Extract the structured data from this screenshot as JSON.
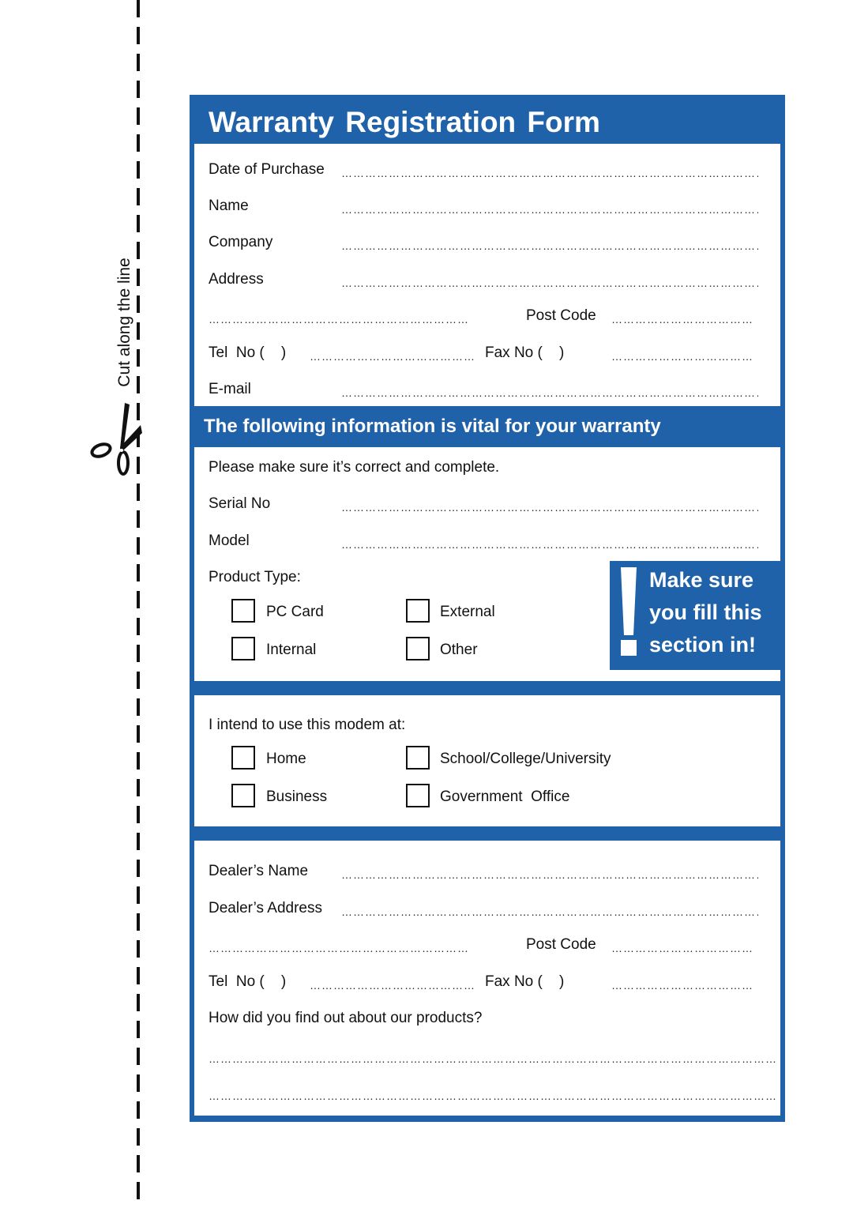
{
  "cut_guide": {
    "text": "Cut along the line"
  },
  "form": {
    "title": "Warranty Registration Form",
    "customer": {
      "date_of_purchase": "Date of Purchase",
      "name": "Name",
      "company": "Company",
      "address": "Address",
      "post_code": "Post Code",
      "tel": "Tel  No (    )",
      "fax": "Fax No (    )",
      "email": "E-mail"
    },
    "vital_heading": "The following information is vital for your warranty",
    "product": {
      "instruction": "Please make sure it’s correct and complete.",
      "serial_no": "Serial No",
      "model": "Model",
      "product_type_label": "Product Type:",
      "options": [
        "PC Card",
        "External",
        "Internal",
        "Other"
      ]
    },
    "callout": {
      "line1": "Make sure",
      "line2": "you fill this",
      "line3": "section in!"
    },
    "usage": {
      "label": "I intend to use this modem at:",
      "options": [
        "Home",
        "School/College/University",
        "Business",
        "Government  Office"
      ]
    },
    "dealer": {
      "name": "Dealer’s Name",
      "address": "Dealer’s Address",
      "post_code": "Post Code",
      "tel": "Tel  No (    )",
      "fax": "Fax No (    )",
      "question": "How did you find out about our products?"
    }
  }
}
